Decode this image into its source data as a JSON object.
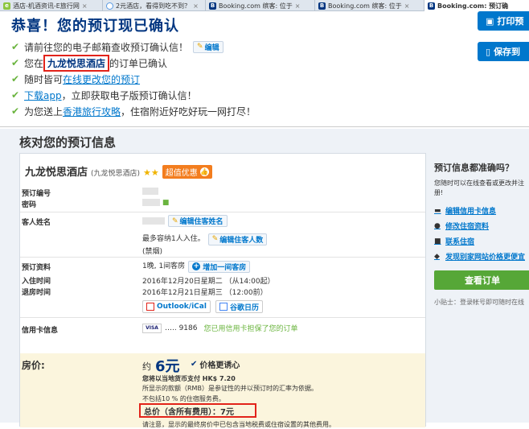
{
  "tabs": [
    {
      "label": "酒店-机酒资讯-E旅行网",
      "icon": "e-travel-icon",
      "color": "#8dc63f"
    },
    {
      "label": "2元酒店，看得到吃不到？",
      "icon": "loading-icon",
      "color": "#5a9be3"
    },
    {
      "label": "Booking.com 缤客: 位于",
      "icon": "booking-icon",
      "color": "#003580"
    },
    {
      "label": "Booking.com 缤客: 位于",
      "icon": "booking-icon",
      "color": "#003580"
    },
    {
      "label": "Booking.com: 预订确",
      "icon": "booking-icon",
      "color": "#003580"
    }
  ],
  "header": {
    "title": "恭喜！您的预订现已确认"
  },
  "bullets": {
    "b1_text": "请前往您的电子邮箱查收预订确认信！",
    "b1_edit": "编辑",
    "b2_prefix": "您在",
    "b2_hotel": "九龙悦思酒店",
    "b2_suffix": "的订单已确认",
    "b3_prefix": "随时皆可",
    "b3_link": "在线更改您的预订",
    "b4_link": "下载app",
    "b4_suffix": "，立即获取电子版预订确认信！",
    "b5_prefix": "为您送上",
    "b5_link": "香港旅行攻略",
    "b5_suffix": "，住宿附近好吃好玩一网打尽！"
  },
  "side_buttons": {
    "print": "打印预",
    "save": "保存到"
  },
  "verify": {
    "heading": "核对您的预订信息",
    "hotel_name": "九龙悦思酒店",
    "hotel_name_sub": "(九龙悦思酒店)",
    "stars": "★★",
    "deal": "超值优惠",
    "labels": {
      "booking_no": "预订编号",
      "pin": "密码",
      "guest": "客人姓名",
      "booking_info": "预订资料",
      "checkin": "入住时间",
      "checkout": "退房时间",
      "card": "信用卡信息"
    },
    "edit_guest_name": "编辑住客姓名",
    "max_occupancy": "最多容纳1人入住。",
    "edit_guest_count": "编辑住客人数",
    "smoking": "(禁烟)",
    "nights_rooms": "1晚, 1间客房",
    "add_room": "增加一间客房",
    "checkin_value": "2016年12月20日星期二 （从14:00起）",
    "checkout_value": "2016年12月21日星期三 （12:00前）",
    "calendar_outlook": "Outlook/iCal",
    "calendar_google": "谷歌日历",
    "card_brand": "VISA",
    "card_last4": "….. 9186",
    "card_note": "您已用信用卡担保了您的订单"
  },
  "price": {
    "label": "房价:",
    "approx": "约",
    "amount": "6元",
    "guarantee": "价格更诱心",
    "local_currency_note": "您将以当地货币支付 HK$ 7.20",
    "rmb_note": "所显示的款额（RMB）是参证性的并以预订时的汇率为依据。",
    "service_note": "不包括10 % 的住宿服务费。",
    "total": "总价（含所有费用）：7元",
    "final_note": "请注意，显示的最终房价中已包含当地税费或住宿设置的其他费用。"
  },
  "sidebar": {
    "title": "预订信息都准确吗？",
    "desc": "您随时可以在线查看或更改并注册!",
    "links": [
      {
        "label": "编辑信用卡信息",
        "icon": "card-icon"
      },
      {
        "label": "修改住宿资料",
        "icon": "person-icon"
      },
      {
        "label": "联系住宿",
        "icon": "chat-icon"
      },
      {
        "label": "发现别家网站价格更便宜",
        "icon": "tag-icon"
      }
    ],
    "view_booking": "查看订单",
    "tip": "小贴士：登录帐号即可随时在线"
  },
  "colors": {
    "brand": "#003580",
    "link": "#0077cc",
    "check": "#6ab43e",
    "highlight": "#e2231a",
    "deal": "#f37d1e",
    "view_button": "#56a737"
  }
}
